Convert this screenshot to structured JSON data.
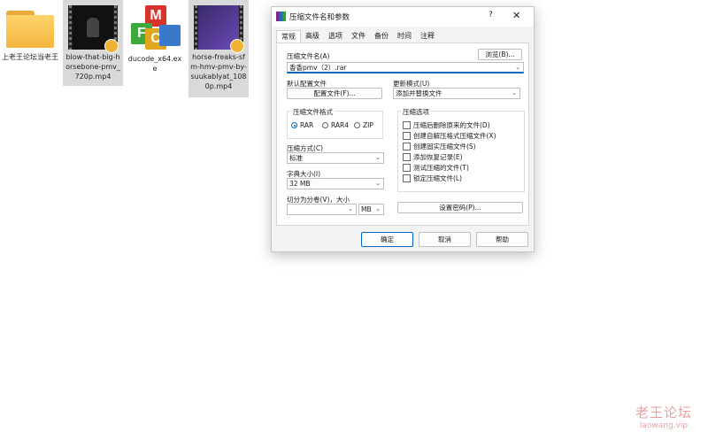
{
  "desktop": {
    "icons": [
      {
        "label": "上老王论坛当老王",
        "type": "folder-icon"
      },
      {
        "label": "blow-that-big-horsebone-pmv_720p.mp4",
        "type": "video-file-icon"
      },
      {
        "label": "ducode_x64.exe",
        "type": "mfc-app-icon"
      },
      {
        "label": "horse-freaks-sfm-hmv-pmv-by-suukablyat_1080p.mp4",
        "type": "video-file-icon"
      }
    ]
  },
  "dialog": {
    "title": "压缩文件名和参数",
    "help_glyph": "?",
    "close_glyph": "✕",
    "tabs": [
      "常规",
      "高级",
      "选项",
      "文件",
      "备份",
      "时间",
      "注释"
    ],
    "archive_name_label": "压缩文件名(A)",
    "browse_label": "浏览(B)...",
    "archive_name_value": "香香pmv（2）.rar",
    "default_profile_label": "默认配置文件",
    "profile_button": "配置文件(F)...",
    "update_mode_label": "更新模式(U)",
    "update_mode_value": "添加并替换文件",
    "format_label": "压缩文件格式",
    "formats": [
      "RAR",
      "RAR4",
      "ZIP"
    ],
    "selected_format": "RAR",
    "method_label": "压缩方式(C)",
    "method_value": "标准",
    "dict_label": "字典大小(I)",
    "dict_value": "32 MB",
    "split_label": "切分为分卷(V)，大小",
    "split_unit": "MB",
    "options_label": "压缩选项",
    "options": [
      "压缩后删除原来的文件(D)",
      "创建自解压格式压缩文件(X)",
      "创建固实压缩文件(S)",
      "添加恢复记录(E)",
      "测试压缩的文件(T)",
      "锁定压缩文件(L)"
    ],
    "password_button": "设置密码(P)...",
    "ok_button": "确定",
    "cancel_button": "取消",
    "help_button": "帮助"
  },
  "watermark": {
    "cn": "老王论坛",
    "url": "laowang.vip"
  },
  "colors": {
    "accent": "#0067c0",
    "watermark": "#e6a3a3",
    "folder": "#f4b53f"
  }
}
